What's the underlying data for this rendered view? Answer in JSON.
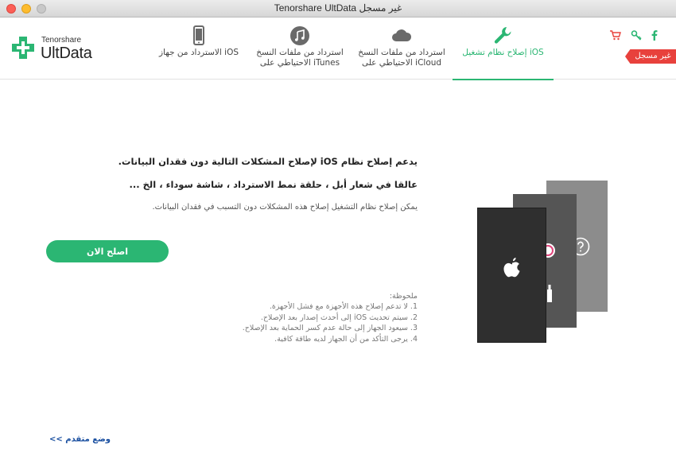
{
  "window": {
    "title": "Tenorshare UltData غير مسجل"
  },
  "logo": {
    "brand": "Tenorshare",
    "product": "UltData"
  },
  "tabs": [
    {
      "id": "device",
      "icon": "phone-icon",
      "label": "الاسترداد من جهاز iOS"
    },
    {
      "id": "itunes",
      "icon": "music-note-icon",
      "label": "استرداد من ملفات النسخ الاحتياطي على iTunes"
    },
    {
      "id": "icloud",
      "icon": "cloud-icon",
      "label": "استرداد من ملفات النسخ الاحتياطي على iCloud"
    },
    {
      "id": "repair",
      "icon": "wrench-icon",
      "label": "إصلاح نظام تشغيل iOS",
      "active": true
    }
  ],
  "header": {
    "unregistered_badge": "غير مسجل"
  },
  "main": {
    "intro": "يدعم إصلاح نظام iOS لإصلاح المشكلات التالية دون فقدان البيانات.",
    "issues": "عالقا في شعار أبل ، حلقة نمط الاسترداد ، شاشة سوداء ، الخ ...",
    "description": "يمكن إصلاح نظام التشغيل إصلاح هذه المشكلات دون التسبب في فقدان البيانات.",
    "fix_button": "اصلح الان",
    "notes_title": "ملحوظة:",
    "notes": [
      "1. لا تدعم إصلاح هذه الأجهزة مع فشل الأجهزة.",
      "2. سيتم تحديث iOS إلى أحدث إصدار بعد الإصلاح.",
      "3. سيعود الجهاز إلى حالة عدم كسر الحماية بعد الإصلاح.",
      "4. يرجى التأكد من أن الجهاز لديه طاقة كافية."
    ],
    "advanced_mode": "وضع متقدم >>"
  },
  "colors": {
    "accent": "#2bb673",
    "badge": "#e8413c",
    "link": "#1a4fa0"
  }
}
